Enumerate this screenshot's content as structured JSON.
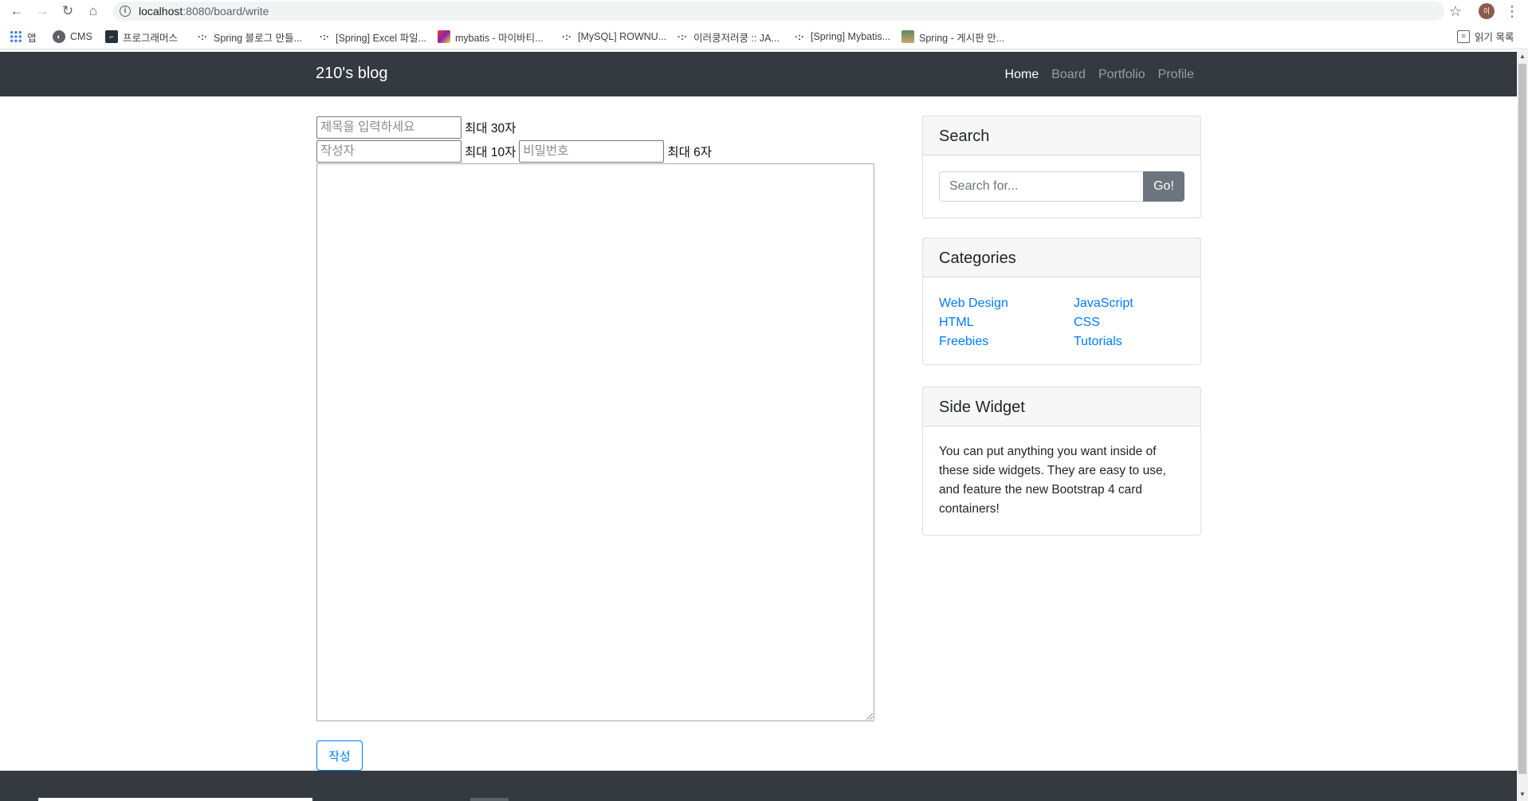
{
  "browser": {
    "url_host": "localhost",
    "url_path": ":8080/board/write",
    "avatar_letter": "이",
    "icons": {
      "back": "←",
      "forward": "→",
      "reload": "↻",
      "home": "⌂",
      "star": "☆",
      "menu": "⋮"
    }
  },
  "bookmarks": {
    "items": [
      {
        "label": "앱",
        "icon": "apps-icon"
      },
      {
        "label": "CMS",
        "icon": "cms-icon"
      },
      {
        "label": "프로그래머스",
        "icon": "programmers-icon"
      },
      {
        "label": "Spring 블로그 만들...",
        "icon": "velog-icon"
      },
      {
        "label": "[Spring] Excel 파일...",
        "icon": "velog-icon"
      },
      {
        "label": "mybatis - 마이바티...",
        "icon": "mybatis-icon"
      },
      {
        "label": "[MySQL] ROWNU...",
        "icon": "velog-icon"
      },
      {
        "label": "이러쿵저러쿵 :: JA...",
        "icon": "velog-icon"
      },
      {
        "label": "[Spring] Mybatis...",
        "icon": "velog-icon"
      },
      {
        "label": "Spring - 게시판 만...",
        "icon": "image-icon"
      }
    ],
    "reading_list": "읽기 목록"
  },
  "navbar": {
    "brand": "210's blog",
    "links": [
      {
        "label": "Home",
        "active": true
      },
      {
        "label": "Board",
        "active": false
      },
      {
        "label": "Portfolio",
        "active": false
      },
      {
        "label": "Profile",
        "active": false
      }
    ]
  },
  "form": {
    "title_placeholder": "제목을 입력하세요",
    "title_hint": "최대 30자",
    "writer_placeholder": "작성자",
    "writer_hint": "최대 10자",
    "password_placeholder": "비밀번호",
    "password_hint": "최대 6자",
    "submit_label": "작성"
  },
  "sidebar": {
    "search": {
      "title": "Search",
      "placeholder": "Search for...",
      "button": "Go!"
    },
    "categories": {
      "title": "Categories",
      "items": [
        "Web Design",
        "JavaScript",
        "HTML",
        "CSS",
        "Freebies",
        "Tutorials"
      ]
    },
    "widget": {
      "title": "Side Widget",
      "text": "You can put anything you want inside of these side widgets. They are easy to use, and feature the new Bootstrap 4 card containers!"
    }
  },
  "colors": {
    "navbar_bg": "#343a40",
    "link": "#007bff",
    "button_secondary": "#6c757d"
  }
}
